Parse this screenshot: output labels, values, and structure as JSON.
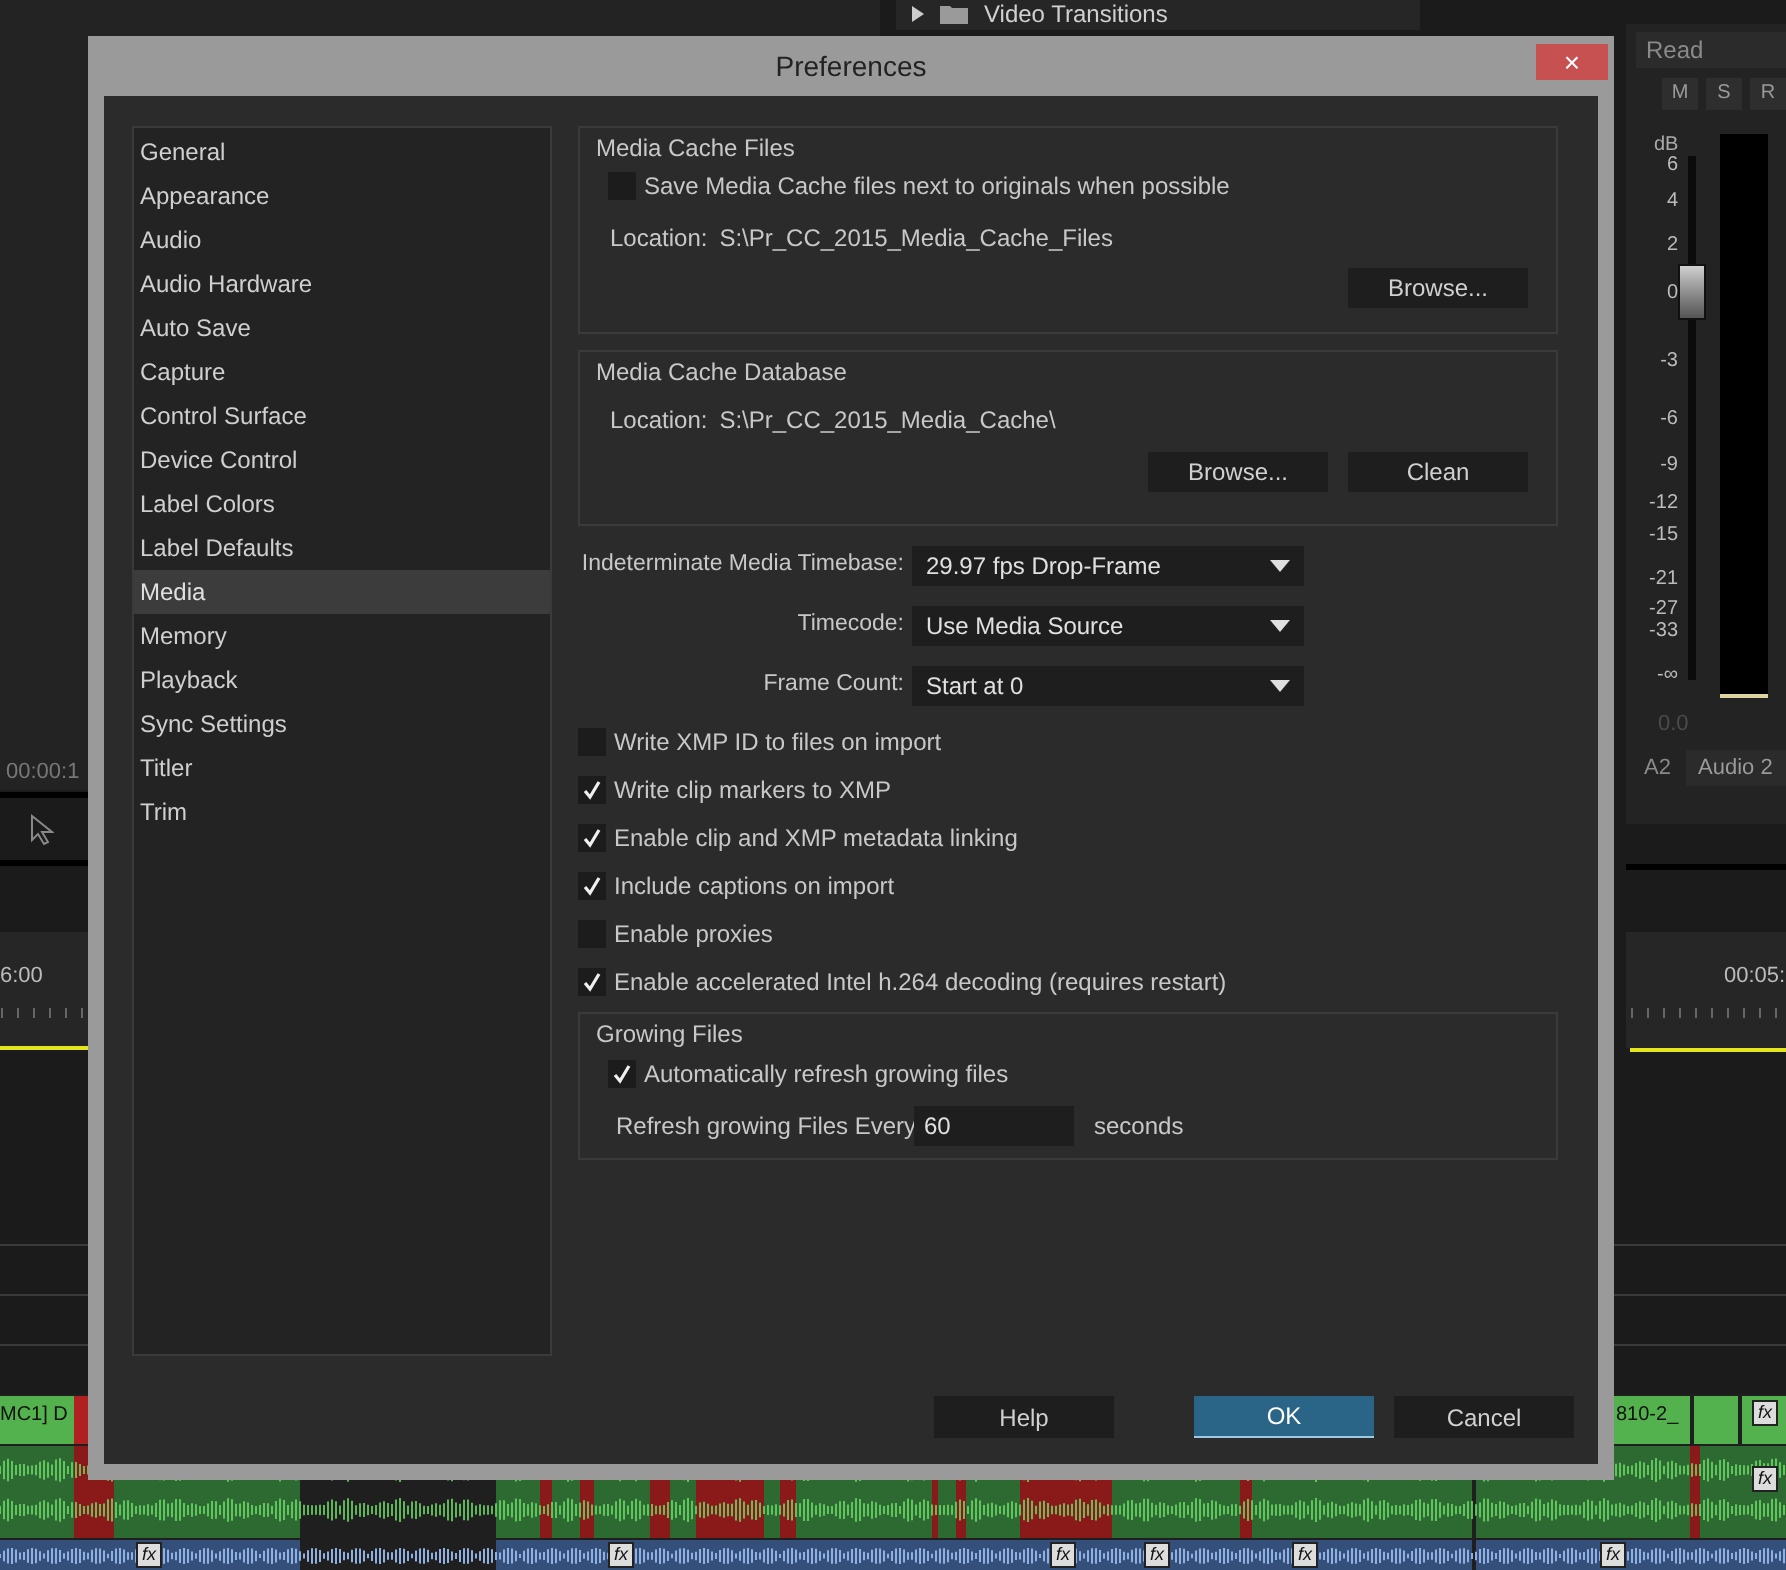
{
  "background": {
    "project_panel": {
      "tree_item": "Video Transitions",
      "expanded": false
    },
    "mixer": {
      "automation_mode": "Read",
      "buttons": [
        "M",
        "S",
        "R"
      ],
      "scale_unit": "dB",
      "scale_labels": [
        "6",
        "4",
        "2",
        "0",
        "-3",
        "-6",
        "-9",
        "-12",
        "-15",
        "-21",
        "-27",
        "-33",
        "-∞"
      ],
      "fader": {
        "level": 0.74
      },
      "readout": "0.0",
      "track": "A2",
      "track_name": "Audio 2"
    },
    "source_timecode": "00:00:1",
    "timeline": {
      "time_left": "6:00",
      "time_right": "00:05:",
      "video_clips": [
        {
          "label": "MC1] D"
        },
        {
          "label": "810-2_"
        }
      ],
      "fx_badges": [
        "fx",
        "fx",
        "fx",
        "fx",
        "fx",
        "fx",
        "fx",
        "fx"
      ]
    }
  },
  "dialog": {
    "title": "Preferences",
    "close": "×",
    "categories": [
      {
        "label": "General",
        "selected": false
      },
      {
        "label": "Appearance",
        "selected": false
      },
      {
        "label": "Audio",
        "selected": false
      },
      {
        "label": "Audio Hardware",
        "selected": false
      },
      {
        "label": "Auto Save",
        "selected": false
      },
      {
        "label": "Capture",
        "selected": false
      },
      {
        "label": "Control Surface",
        "selected": false
      },
      {
        "label": "Device Control",
        "selected": false
      },
      {
        "label": "Label Colors",
        "selected": false
      },
      {
        "label": "Label Defaults",
        "selected": false
      },
      {
        "label": "Media",
        "selected": true
      },
      {
        "label": "Memory",
        "selected": false
      },
      {
        "label": "Playback",
        "selected": false
      },
      {
        "label": "Sync Settings",
        "selected": false
      },
      {
        "label": "Titler",
        "selected": false
      },
      {
        "label": "Trim",
        "selected": false
      }
    ],
    "media_cache_files": {
      "title": "Media Cache Files",
      "checkbox": {
        "label": "Save Media Cache files next to originals when possible",
        "checked": false
      },
      "location_label": "Location:",
      "location": "S:\\Pr_CC_2015_Media_Cache_Files",
      "buttons": [
        "Browse..."
      ]
    },
    "media_cache_database": {
      "title": "Media Cache Database",
      "location_label": "Location:",
      "location": "S:\\Pr_CC_2015_Media_Cache\\",
      "buttons": [
        "Browse...",
        "Clean"
      ]
    },
    "dropdowns": [
      {
        "label": "Indeterminate Media Timebase:",
        "value": "29.97 fps Drop-Frame"
      },
      {
        "label": "Timecode:",
        "value": "Use Media Source"
      },
      {
        "label": "Frame Count:",
        "value": "Start at 0"
      }
    ],
    "checkboxes": [
      {
        "label": "Write XMP ID to files on import",
        "checked": false
      },
      {
        "label": "Write clip markers to XMP",
        "checked": true
      },
      {
        "label": "Enable clip and XMP metadata linking",
        "checked": true
      },
      {
        "label": "Include captions on import",
        "checked": true
      },
      {
        "label": "Enable proxies",
        "checked": false
      },
      {
        "label": "Enable accelerated Intel h.264 decoding (requires restart)",
        "checked": true
      }
    ],
    "growing_files": {
      "title": "Growing Files",
      "checkbox": {
        "label": "Automatically refresh growing files",
        "checked": true
      },
      "refresh_label": "Refresh growing Files Every",
      "refresh_value": "60",
      "unit": "seconds"
    },
    "buttons": [
      {
        "label": "Help",
        "primary": false
      },
      {
        "label": "OK",
        "primary": true
      },
      {
        "label": "Cancel",
        "primary": false
      }
    ]
  }
}
